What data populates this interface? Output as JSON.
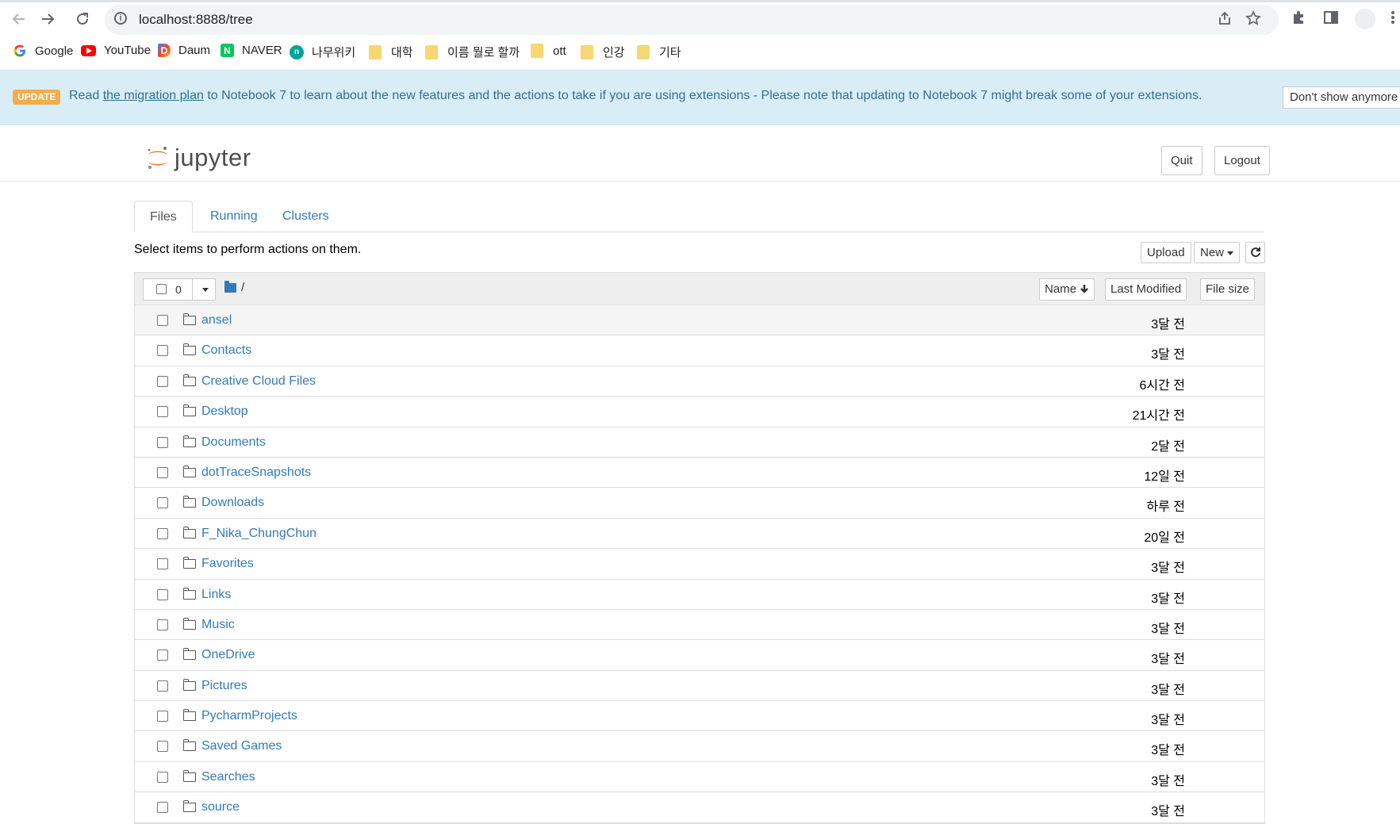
{
  "browser": {
    "url": "localhost:8888/tree",
    "bookmarks": [
      {
        "label": "Google",
        "icon": "google-icon"
      },
      {
        "label": "YouTube",
        "icon": "youtube-icon"
      },
      {
        "label": "Daum",
        "icon": "daum-icon"
      },
      {
        "label": "NAVER",
        "icon": "naver-icon"
      },
      {
        "label": "나무위키",
        "icon": "namuwiki-icon"
      },
      {
        "label": "대학",
        "icon": "folder-icon"
      },
      {
        "label": "이름 뭘로 할까",
        "icon": "folder-icon"
      },
      {
        "label": "ott",
        "icon": "folder-icon"
      },
      {
        "label": "인강",
        "icon": "folder-icon"
      },
      {
        "label": "기타",
        "icon": "folder-icon"
      }
    ]
  },
  "banner": {
    "badge": "UPDATE",
    "prefix": "Read ",
    "link": "the migration plan",
    "suffix": " to Notebook 7 to learn about the new features and the actions to take if you are using extensions - Please note that updating to Notebook 7 might break some of your extensions.",
    "dismiss_label": "Don't show anymore"
  },
  "header": {
    "logo_text": "jupyter",
    "quit_label": "Quit",
    "logout_label": "Logout"
  },
  "tabs": [
    {
      "label": "Files",
      "active": true
    },
    {
      "label": "Running",
      "active": false
    },
    {
      "label": "Clusters",
      "active": false
    }
  ],
  "toolbar": {
    "select_message": "Select items to perform actions on them.",
    "upload_label": "Upload",
    "new_label": "New"
  },
  "list_header": {
    "selected_count": "0",
    "breadcrumb": "/",
    "sort_name_label": "Name",
    "sort_modified_label": "Last Modified",
    "sort_size_label": "File size"
  },
  "files": [
    {
      "name": "ansel",
      "modified": "3달 전"
    },
    {
      "name": "Contacts",
      "modified": "3달 전"
    },
    {
      "name": "Creative Cloud Files",
      "modified": "6시간 전"
    },
    {
      "name": "Desktop",
      "modified": "21시간 전"
    },
    {
      "name": "Documents",
      "modified": "2달 전"
    },
    {
      "name": "dotTraceSnapshots",
      "modified": "12일 전"
    },
    {
      "name": "Downloads",
      "modified": "하루 전"
    },
    {
      "name": "F_Nika_ChungChun",
      "modified": "20일 전"
    },
    {
      "name": "Favorites",
      "modified": "3달 전"
    },
    {
      "name": "Links",
      "modified": "3달 전"
    },
    {
      "name": "Music",
      "modified": "3달 전"
    },
    {
      "name": "OneDrive",
      "modified": "3달 전"
    },
    {
      "name": "Pictures",
      "modified": "3달 전"
    },
    {
      "name": "PycharmProjects",
      "modified": "3달 전"
    },
    {
      "name": "Saved Games",
      "modified": "3달 전"
    },
    {
      "name": "Searches",
      "modified": "3달 전"
    },
    {
      "name": "source",
      "modified": "3달 전"
    }
  ],
  "colors": {
    "link": "#337ab7",
    "banner_bg": "#d9edf7",
    "banner_text": "#31708f",
    "badge": "#f0ad4e",
    "jupyter_orange": "#f37726"
  }
}
